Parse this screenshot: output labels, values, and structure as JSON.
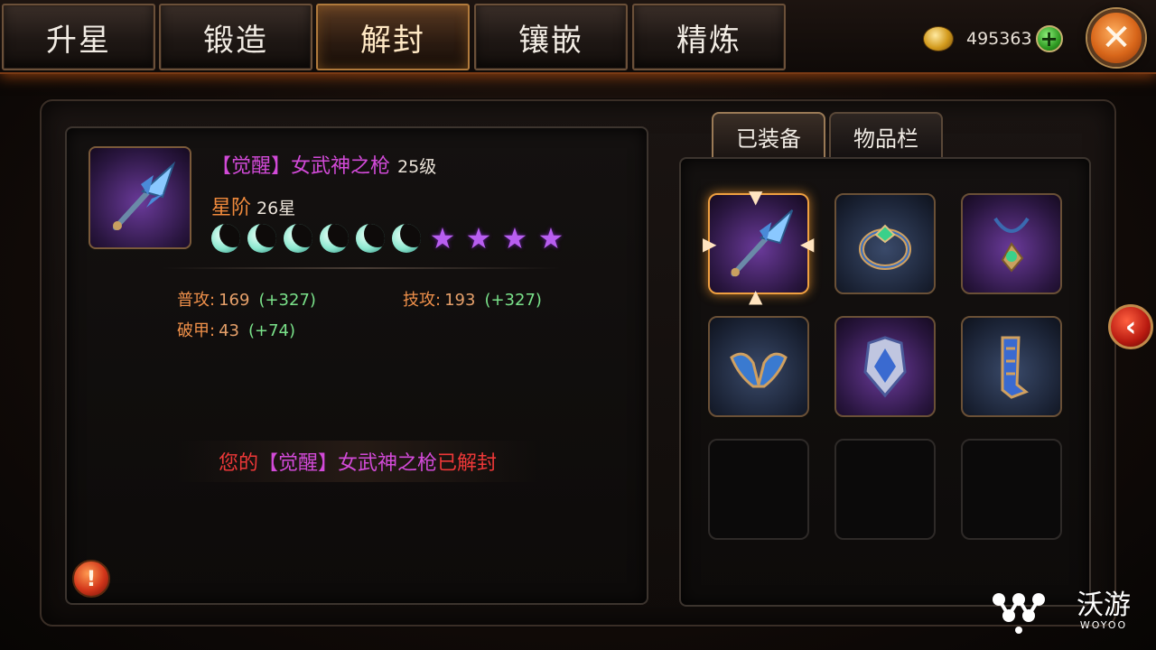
{
  "tabs": [
    "升星",
    "锻造",
    "解封",
    "镶嵌",
    "精炼"
  ],
  "active_tab_index": 2,
  "gold": {
    "amount": "495363"
  },
  "item": {
    "name_bracket": "【觉醒】女武神之枪",
    "level": "25级",
    "star_label": "星阶",
    "star_value": "26星",
    "moons": 6,
    "stars": 4
  },
  "stats": [
    {
      "label": "普攻:",
      "value": "169",
      "bonus": "(+327)"
    },
    {
      "label": "技攻:",
      "value": "193",
      "bonus": "(+327)"
    },
    {
      "label": "破甲:",
      "value": "43",
      "bonus": "(+74)"
    }
  ],
  "notice": {
    "prefix": "您的",
    "item": "【觉醒】女武神之枪",
    "suffix": "已解封"
  },
  "warn_label": "!",
  "close_label": "✕",
  "plus_label": "+",
  "side_label": "‹",
  "right_tabs": [
    "已装备",
    "物品栏"
  ],
  "active_right_tab": 0,
  "slots": [
    {
      "icon": "spear-icon",
      "selected": true
    },
    {
      "icon": "ring-icon"
    },
    {
      "icon": "necklace-icon"
    },
    {
      "icon": "wings-helmet-icon"
    },
    {
      "icon": "chest-armor-icon"
    },
    {
      "icon": "greaves-icon"
    },
    {
      "icon": "empty"
    },
    {
      "icon": "empty"
    },
    {
      "icon": "empty"
    }
  ],
  "watermark": {
    "text": "沃游",
    "sub": "WOYOO"
  }
}
